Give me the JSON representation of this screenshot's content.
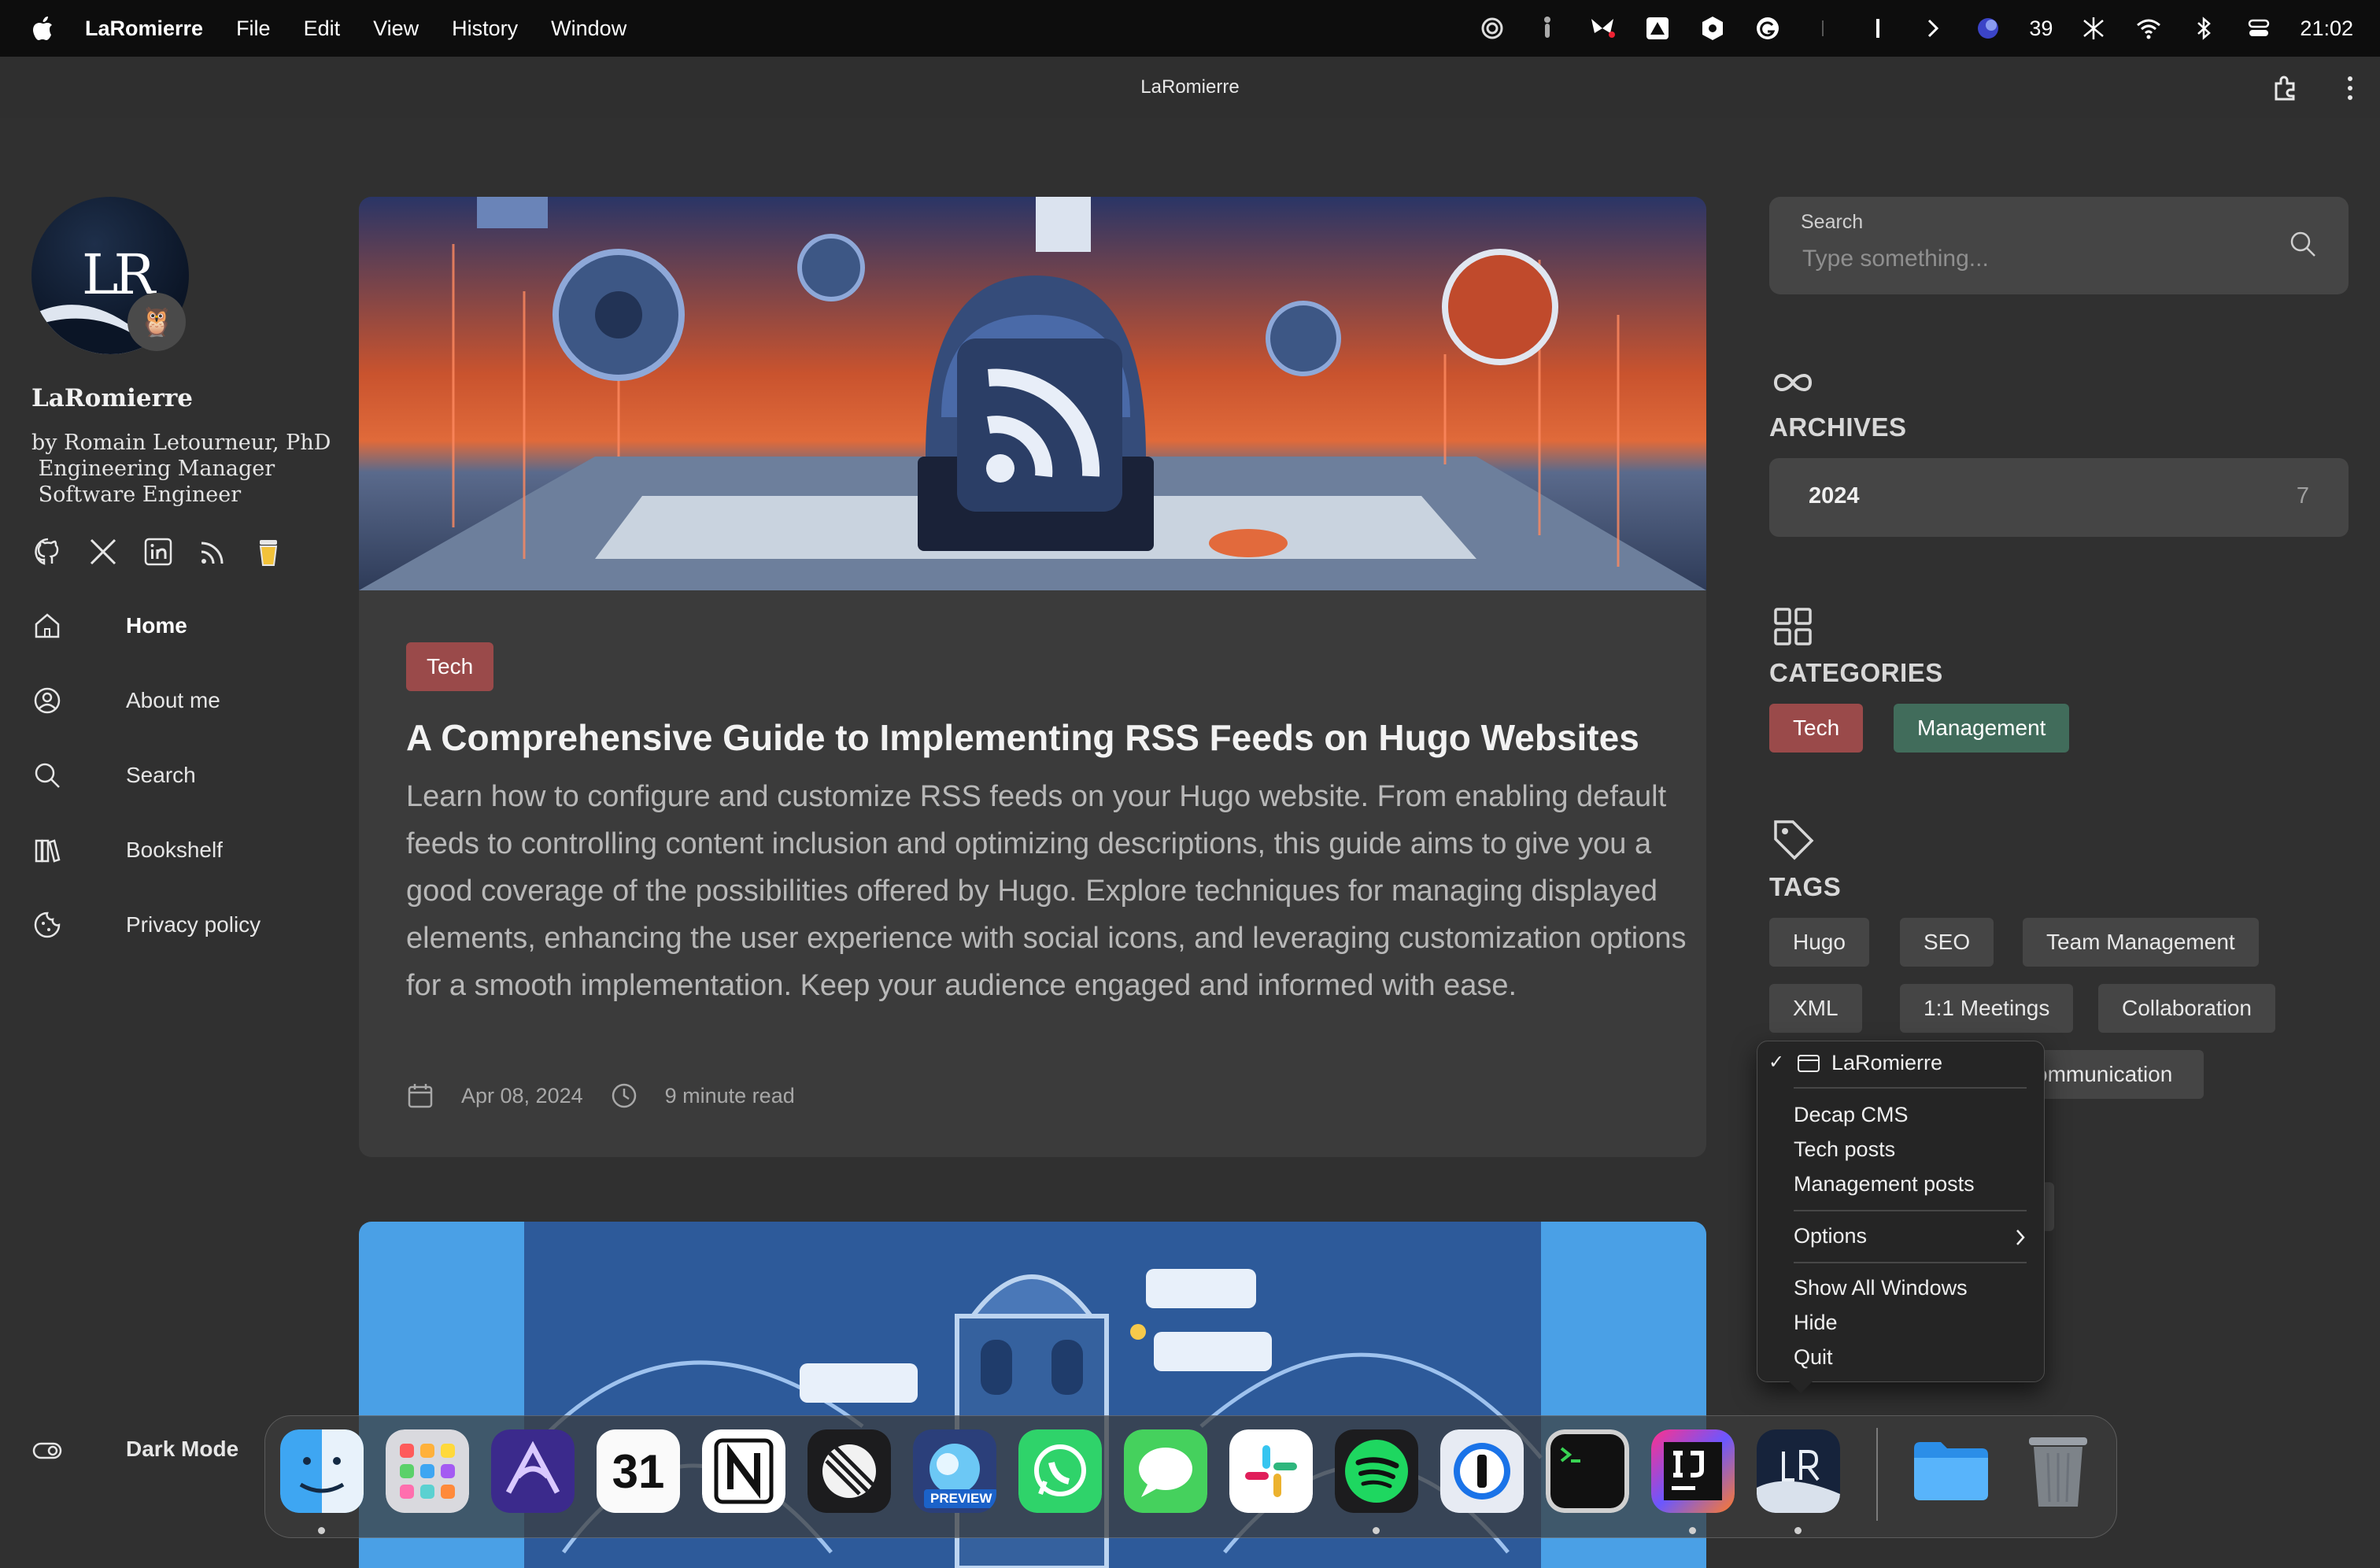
{
  "menubar": {
    "app_name": "LaRomierre",
    "items": [
      "File",
      "Edit",
      "View",
      "History",
      "Window"
    ],
    "status_count": "39",
    "clock": "21:02"
  },
  "window": {
    "title": "LaRomierre"
  },
  "profile": {
    "avatar_text": "LR",
    "name": "LaRomierre",
    "tagline": "by Romain Letourneur, PhD\n Engineering Manager\n Software Engineer",
    "socials": [
      "github-icon",
      "x-icon",
      "linkedin-icon",
      "rss-icon",
      "coffee-icon"
    ]
  },
  "nav": {
    "items": [
      {
        "label": "Home",
        "icon": "home-icon",
        "active": true
      },
      {
        "label": "About me",
        "icon": "user-icon"
      },
      {
        "label": "Search",
        "icon": "search-icon"
      },
      {
        "label": "Bookshelf",
        "icon": "books-icon"
      },
      {
        "label": "Privacy policy",
        "icon": "cookie-icon"
      }
    ],
    "dark_mode": "Dark Mode"
  },
  "post": {
    "category": "Tech",
    "title": "A Comprehensive Guide to Implementing RSS Feeds on Hugo Websites",
    "description": "Learn how to configure and customize RSS feeds on your Hugo website. From enabling default feeds to controlling content inclusion and optimizing descriptions, this guide aims to give you a good coverage of the possibilities offered by Hugo. Explore techniques for managing displayed elements, enhancing the user experience with social icons, and leveraging customization options for a smooth implementation. Keep your audience engaged and informed with ease.",
    "date": "Apr 08, 2024",
    "read_time": "9 minute read"
  },
  "search": {
    "label": "Search",
    "placeholder": "Type something..."
  },
  "archives": {
    "title": "ARCHIVES",
    "year": "2024",
    "count": "7"
  },
  "categories": {
    "title": "CATEGORIES",
    "items": [
      "Tech",
      "Management"
    ]
  },
  "tags": {
    "title": "TAGS",
    "items": [
      "Hugo",
      "SEO",
      "Team Management",
      "XML",
      "1:1 Meetings",
      "Collaboration",
      "ommunication"
    ]
  },
  "context_menu": {
    "current": "LaRomierre",
    "windows": [
      "Decap CMS",
      "Tech posts",
      "Management posts"
    ],
    "options": "Options",
    "actions": [
      "Show All Windows",
      "Hide",
      "Quit"
    ]
  },
  "dock": {
    "apps": [
      "Finder",
      "Launchpad",
      "Affinity",
      "Calendar",
      "Notion",
      "Linear",
      "Preview",
      "WhatsApp",
      "Messages",
      "Slack",
      "Spotify",
      "1Password",
      "Terminal",
      "IntelliJ IDEA",
      "LaRomierre",
      "Files",
      "Trash"
    ],
    "calendar_day": "31",
    "preview_label": "PREVIEW"
  },
  "colors": {
    "background": "#303030",
    "card": "#3b3b3b",
    "tech_badge": "#9a4a4a",
    "management_badge": "#416c5b"
  }
}
